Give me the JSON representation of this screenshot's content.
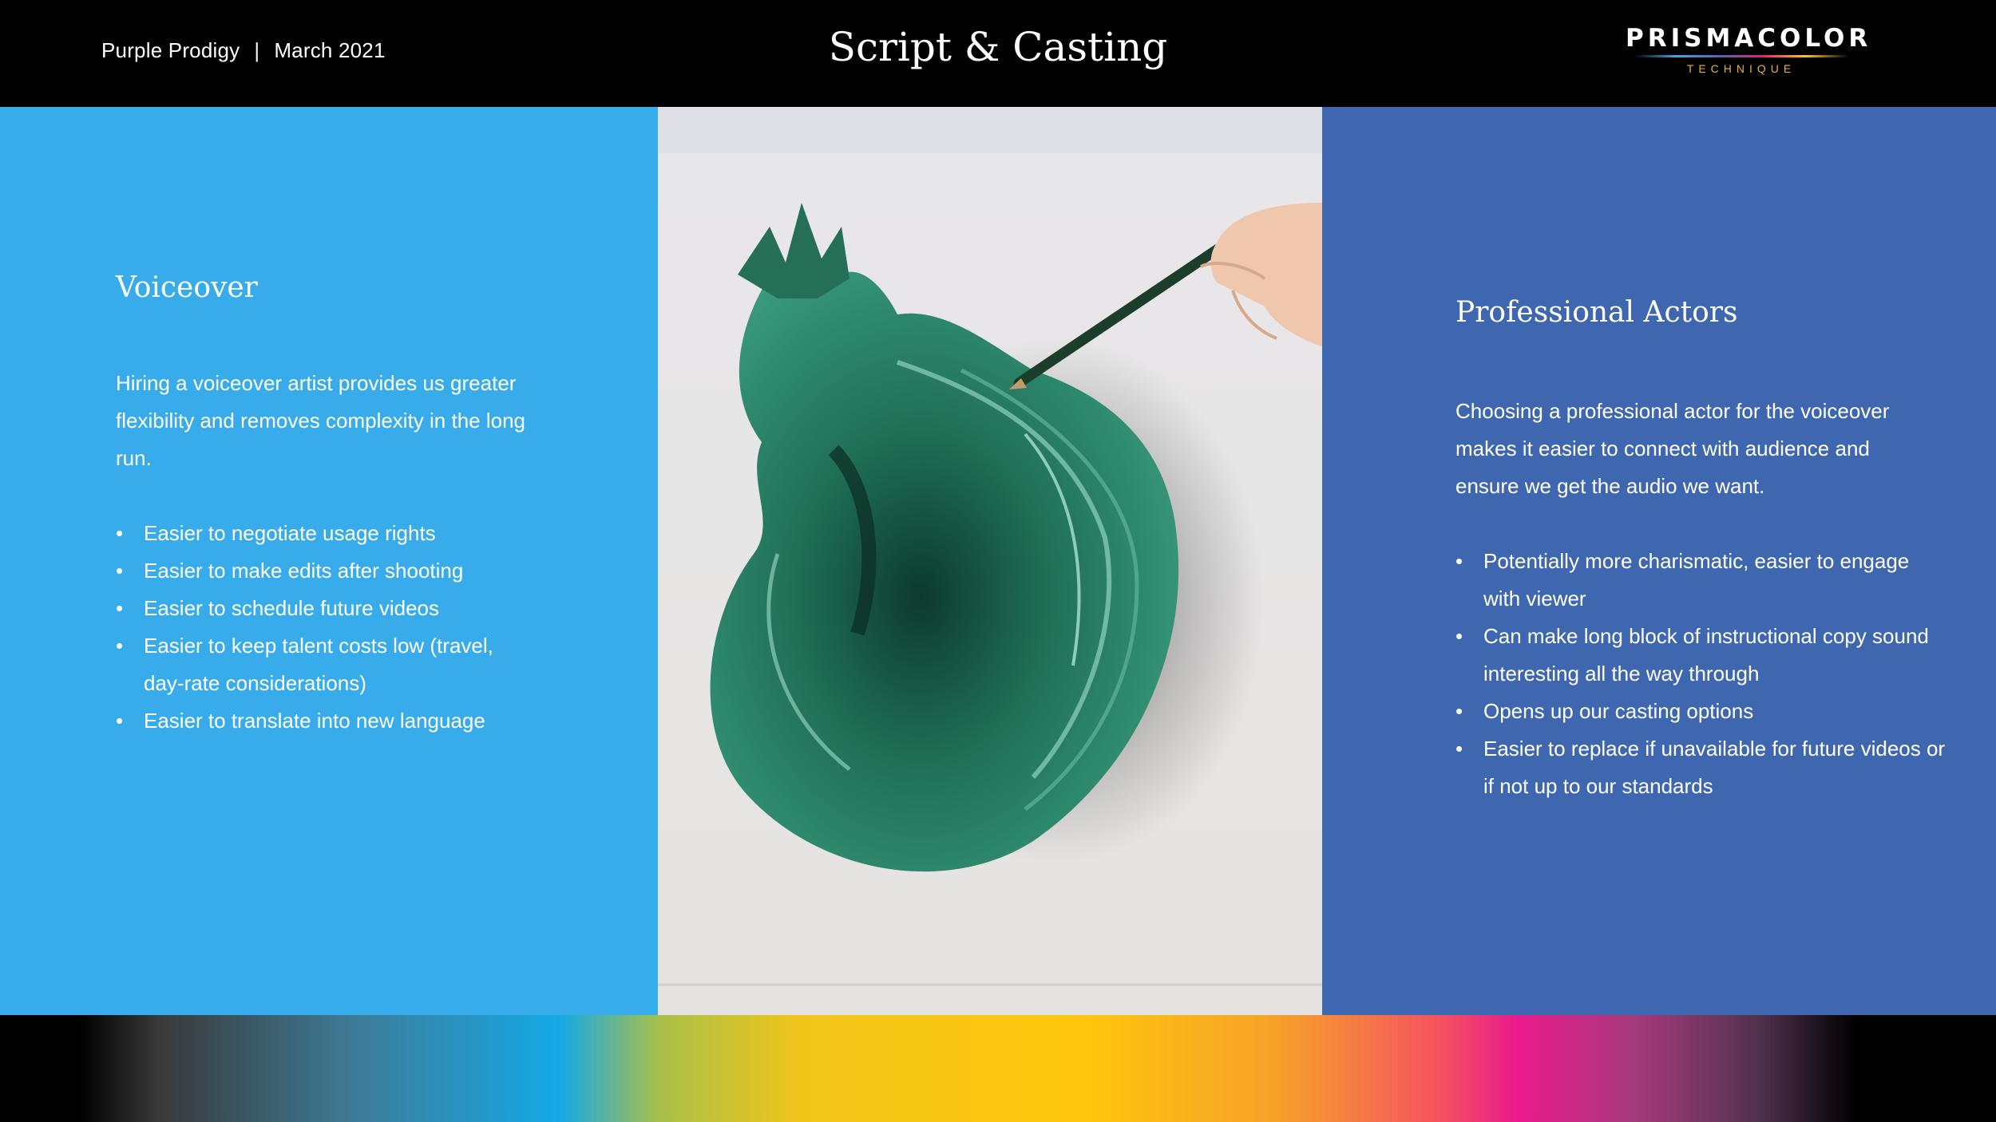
{
  "header": {
    "company": "Purple Prodigy",
    "separator": "|",
    "date": "March 2021",
    "title": "Script & Casting",
    "logo_brand": "PRISMACOLOR",
    "logo_tagline": "TECHNIQUE"
  },
  "left": {
    "heading": "Voiceover",
    "paragraph": "Hiring a voiceover artist provides us greater flexibility and removes complexity in the long run.",
    "bullets": [
      "Easier to negotiate usage rights",
      "Easier to make edits after shooting",
      "Easier to schedule future videos",
      "Easier to keep talent costs low (travel, day-rate considerations)",
      "Easier to translate into new language"
    ],
    "background": "#38aceb"
  },
  "middle": {
    "image": "hand-drawing-green-paint-swirl-illustration"
  },
  "right": {
    "heading": "Professional Actors",
    "paragraph": "Choosing a professional actor for the voiceover makes it easier to connect with audience and ensure we get the audio we want.",
    "bullets": [
      "Potentially more charismatic, easier to engage with viewer",
      "Can make long block of instructional copy sound interesting all the way through",
      "Opens up our casting options",
      "Easier to replace if unavailable for future videos or if not up to our standards"
    ],
    "background": "#3e67af"
  },
  "footer": {
    "style": "rainbow-gradient-band"
  }
}
